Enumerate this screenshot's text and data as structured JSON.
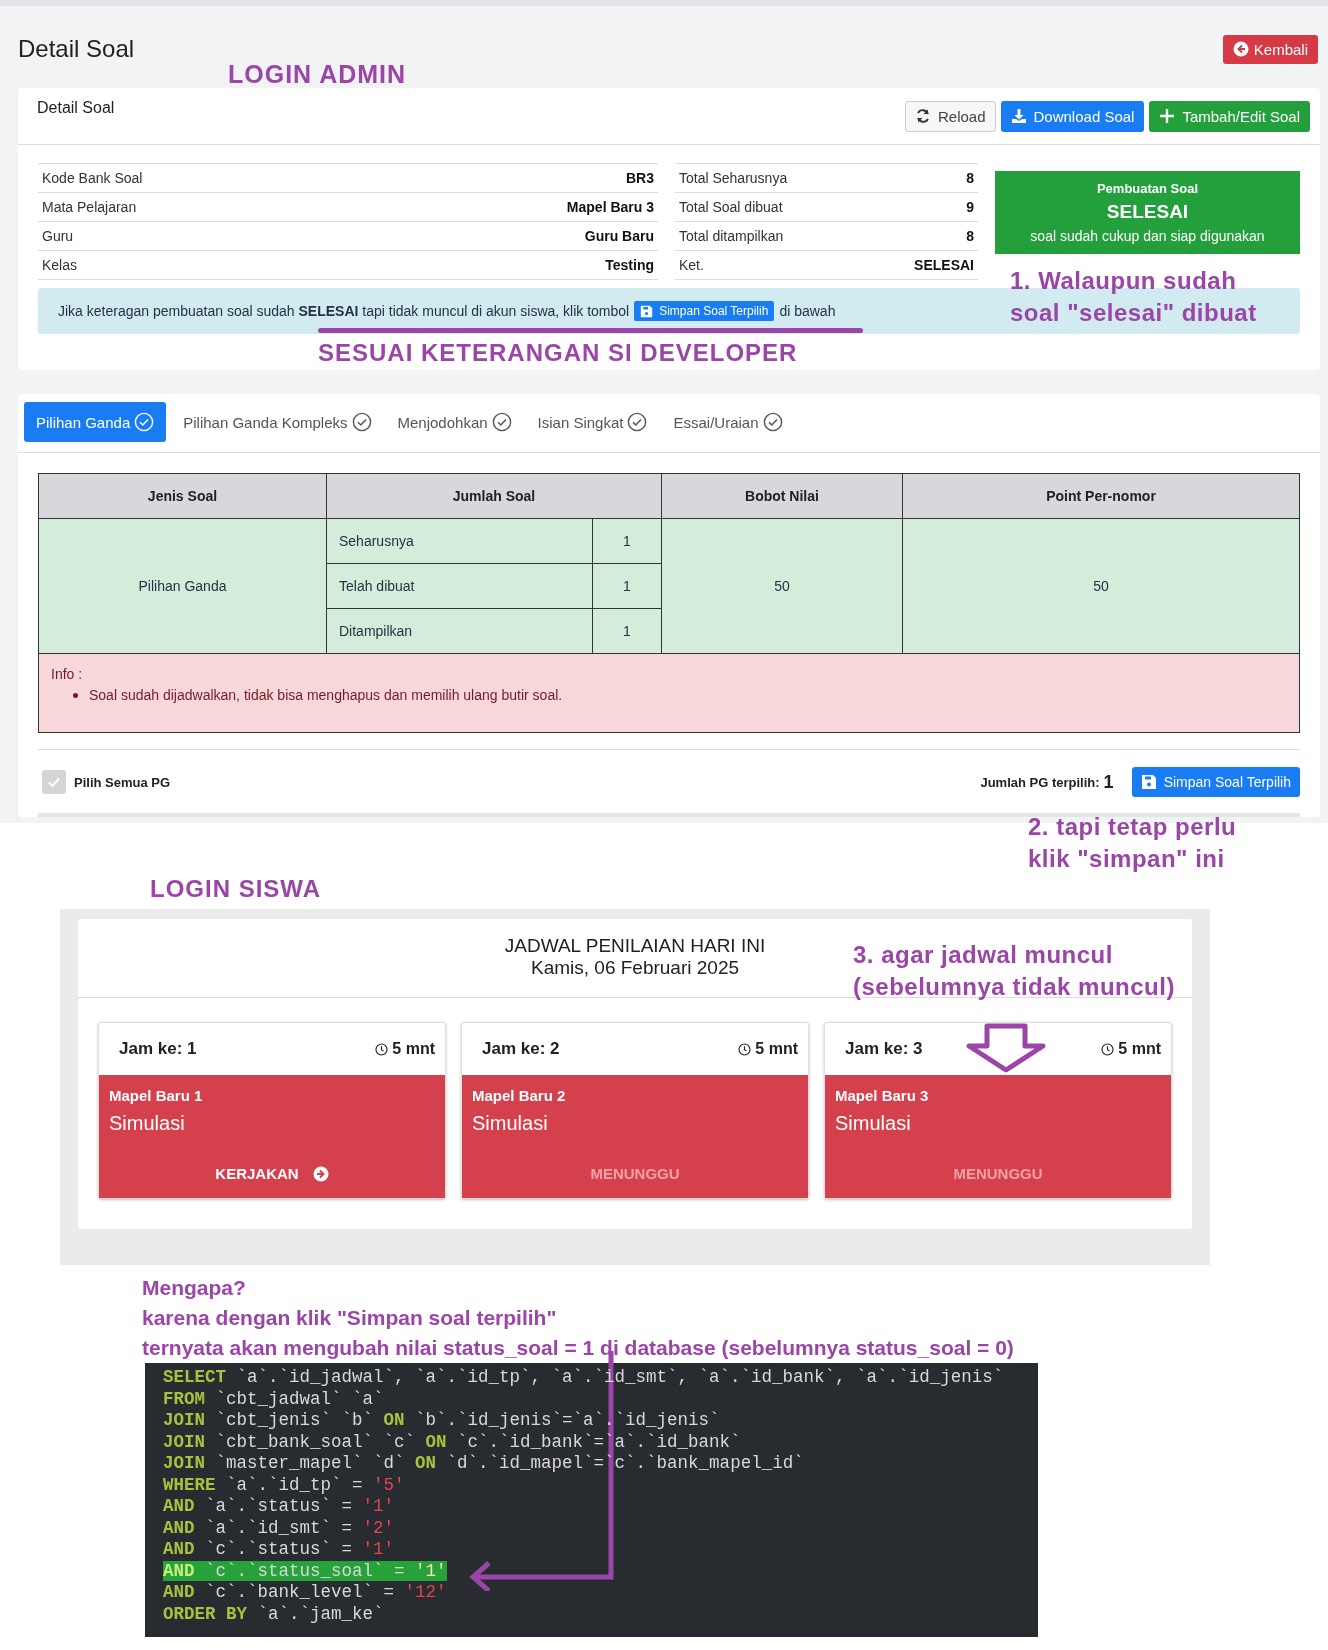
{
  "annotations": {
    "login_admin": "LOGIN ADMIN",
    "note_1": [
      "1. Walaupun sudah",
      "soal \"selesai\" dibuat"
    ],
    "developer_note": "SESUAI KETERANGAN SI DEVELOPER",
    "note_2": [
      "2. tapi tetap perlu",
      "klik \"simpan\" ini"
    ],
    "login_siswa": "LOGIN SISWA",
    "note_3": [
      "3. agar jadwal muncul",
      "(sebelumnya tidak muncul)"
    ],
    "explanation": [
      "Mengapa?",
      "karena dengan klik \"Simpan soal terpilih\"",
      "ternyata akan mengubah nilai status_soal = 1 di database  (sebelumnya status_soal = 0)"
    ]
  },
  "admin": {
    "page_title": "Detail Soal",
    "back_button": "Kembali",
    "card_title": "Detail Soal",
    "toolbar_buttons": [
      {
        "label": "Reload",
        "kind": "reload"
      },
      {
        "label": "Download Soal",
        "kind": "download"
      },
      {
        "label": "Tambah/Edit Soal",
        "kind": "add"
      }
    ],
    "info_left": [
      {
        "label": "Kode Bank Soal",
        "value": "BR3"
      },
      {
        "label": "Mata Pelajaran",
        "value": "Mapel Baru 3"
      },
      {
        "label": "Guru",
        "value": "Guru Baru"
      },
      {
        "label": "Kelas",
        "value": "Testing"
      }
    ],
    "info_right": [
      {
        "label": "Total Seharusnya",
        "value": "8"
      },
      {
        "label": "Total Soal dibuat",
        "value": "9"
      },
      {
        "label": "Total ditampilkan",
        "value": "8"
      },
      {
        "label": "Ket.",
        "value": "SELESAI"
      }
    ],
    "status_box": {
      "heading": "Pembuatan Soal",
      "status": "SELESAI",
      "note": "soal sudah cukup dan siap digunakan"
    },
    "alert": {
      "text": "Jika keteragan pembuatan soal sudah **SELESAI** tapi tidak muncul di akun siswa, klik tombol",
      "button": "Simpan Soal Terpilih",
      "suffix": "di bawah"
    },
    "tabs": [
      {
        "label": "Pilihan Ganda",
        "selected": true
      },
      {
        "label": "Pilihan Ganda Kompleks",
        "selected": false
      },
      {
        "label": "Menjodohkan",
        "selected": false
      },
      {
        "label": "Isian Singkat",
        "selected": false
      },
      {
        "label": "Essai/Uraian",
        "selected": false
      }
    ],
    "summary_table": {
      "columns": [
        "Jenis Soal",
        "Jumlah Soal",
        "Bobot Nilai",
        "Point Per-nomor"
      ],
      "type": "Pilihan Ganda",
      "counts": [
        {
          "label": "Seharusnya",
          "value": "1"
        },
        {
          "label": "Telah dibuat",
          "value": "1"
        },
        {
          "label": "Ditampilkan",
          "value": "1"
        }
      ],
      "bobot": "50",
      "point": "50"
    },
    "info_box": {
      "title": "Info :",
      "items": [
        "Soal sudah dijadwalkan, tidak bisa menghapus dan memilih ulang butir soal."
      ]
    },
    "select_all": {
      "label": "Pilih Semua PG",
      "checked": true,
      "disabled": true
    },
    "selected_count_label": "Jumlah PG terpilih:",
    "selected_count": "1",
    "save_button": "Simpan Soal Terpilih"
  },
  "student": {
    "title": "JADWAL PENILAIAN HARI INI",
    "date": "Kamis, 06 Februari 2025",
    "sessions": [
      {
        "jam": "Jam ke: 1",
        "duration": "5 mnt",
        "subject": "Mapel Baru 1",
        "name": "Simulasi",
        "action": "KERJAKAN",
        "kind": "start"
      },
      {
        "jam": "Jam ke: 2",
        "duration": "5 mnt",
        "subject": "Mapel Baru 2",
        "name": "Simulasi",
        "action": "MENUNGGU",
        "kind": "waiting"
      },
      {
        "jam": "Jam ke: 3",
        "duration": "5 mnt",
        "subject": "Mapel Baru 3",
        "name": "Simulasi",
        "action": "MENUNGGU",
        "kind": "waiting"
      }
    ]
  },
  "code_block": {
    "lines": [
      {
        "highlighted": false,
        "tokens": [
          {
            "kind": "kw",
            "text": "SELECT"
          },
          {
            "kind": "plain",
            "text": " `a`.`id_jadwal`, `a`.`id_tp`, `a`.`id_smt`, `a`.`id_bank`, `a`.`id_jenis`"
          }
        ]
      },
      {
        "highlighted": false,
        "tokens": [
          {
            "kind": "kw",
            "text": "FROM"
          },
          {
            "kind": "plain",
            "text": " `cbt_jadwal` `a`"
          }
        ]
      },
      {
        "highlighted": false,
        "tokens": [
          {
            "kind": "kw",
            "text": "JOIN"
          },
          {
            "kind": "plain",
            "text": " `cbt_jenis` `b` "
          },
          {
            "kind": "kw",
            "text": "ON"
          },
          {
            "kind": "plain",
            "text": " `b`.`id_jenis`=`a`.`id_jenis`"
          }
        ]
      },
      {
        "highlighted": false,
        "tokens": [
          {
            "kind": "kw",
            "text": "JOIN"
          },
          {
            "kind": "plain",
            "text": " `cbt_bank_soal` `c` "
          },
          {
            "kind": "kw",
            "text": "ON"
          },
          {
            "kind": "plain",
            "text": " `c`.`id_bank`=`a`.`id_bank`"
          }
        ]
      },
      {
        "highlighted": false,
        "tokens": [
          {
            "kind": "kw",
            "text": "JOIN"
          },
          {
            "kind": "plain",
            "text": " `master_mapel` `d` "
          },
          {
            "kind": "kw",
            "text": "ON"
          },
          {
            "kind": "plain",
            "text": " `d`.`id_mapel`=`c`.`bank_mapel_id`"
          }
        ]
      },
      {
        "highlighted": false,
        "tokens": [
          {
            "kind": "kw",
            "text": "WHERE"
          },
          {
            "kind": "plain",
            "text": " `a`.`id_tp` = "
          },
          {
            "kind": "str",
            "text": "'5'"
          }
        ]
      },
      {
        "highlighted": false,
        "tokens": [
          {
            "kind": "kw",
            "text": "AND"
          },
          {
            "kind": "plain",
            "text": " `a`.`status` = "
          },
          {
            "kind": "str",
            "text": "'1'"
          }
        ]
      },
      {
        "highlighted": false,
        "tokens": [
          {
            "kind": "kw",
            "text": "AND"
          },
          {
            "kind": "plain",
            "text": " `a`.`id_smt` = "
          },
          {
            "kind": "str",
            "text": "'2'"
          }
        ]
      },
      {
        "highlighted": false,
        "tokens": [
          {
            "kind": "kw",
            "text": "AND"
          },
          {
            "kind": "plain",
            "text": " `c`.`status` = "
          },
          {
            "kind": "str",
            "text": "'1'"
          }
        ]
      },
      {
        "highlighted": true,
        "tokens": [
          {
            "kind": "kw",
            "text": "AND"
          },
          {
            "kind": "plain",
            "text": " `c`.`status_soal` = "
          },
          {
            "kind": "str",
            "text": "'1'"
          }
        ]
      },
      {
        "highlighted": false,
        "tokens": [
          {
            "kind": "kw",
            "text": "AND"
          },
          {
            "kind": "plain",
            "text": " `c`.`bank_level` = "
          },
          {
            "kind": "str",
            "text": "'12'"
          }
        ]
      },
      {
        "highlighted": false,
        "tokens": [
          {
            "kind": "kw",
            "text": "ORDER BY"
          },
          {
            "kind": "plain",
            "text": " `a`.`jam_ke`"
          }
        ]
      }
    ]
  }
}
